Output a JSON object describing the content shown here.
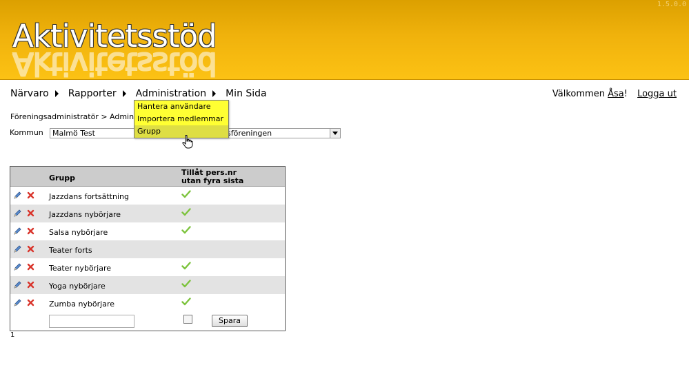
{
  "header": {
    "version": "1.5.0.0",
    "logo_text": "Aktivitetsstöd"
  },
  "nav": {
    "items": [
      {
        "label": "Närvaro"
      },
      {
        "label": "Rapporter"
      },
      {
        "label": "Administration"
      },
      {
        "label": "Min Sida"
      }
    ]
  },
  "user": {
    "welcome_prefix": "Välkommen",
    "name": "Åsa",
    "suffix": "!",
    "logout": "Logga ut"
  },
  "dropdown": {
    "items": [
      {
        "label": "Hantera användare"
      },
      {
        "label": "Importera medlemmar"
      },
      {
        "label": "Grupp"
      }
    ]
  },
  "breadcrumb": {
    "text": "Föreningsadministratör > Admin"
  },
  "filter": {
    "kommun_label": "Kommun",
    "kommun_value": "Malmö Test",
    "forening_value": "insföreningen"
  },
  "grid": {
    "col_grupp": "Grupp",
    "col_tillat_1": "Tillåt pers.nr",
    "col_tillat_2": "utan fyra sista",
    "rows": [
      {
        "name": "Jazzdans fortsättning",
        "allowed": true
      },
      {
        "name": "Jazzdans nybörjare",
        "allowed": true
      },
      {
        "name": "Salsa nybörjare",
        "allowed": true
      },
      {
        "name": "Teater forts",
        "allowed": false
      },
      {
        "name": "Teater nybörjare",
        "allowed": true
      },
      {
        "name": "Yoga nybörjare",
        "allowed": true
      },
      {
        "name": "Zumba nybörjare",
        "allowed": true
      }
    ],
    "new_name_value": "",
    "save_label": "Spara"
  },
  "pager": {
    "page": "1"
  },
  "colors": {
    "header_top": "#dca000",
    "header_bottom": "#fcc214",
    "dropdown_bg": "#ffff33",
    "row_alt": "#e3e3e3"
  }
}
